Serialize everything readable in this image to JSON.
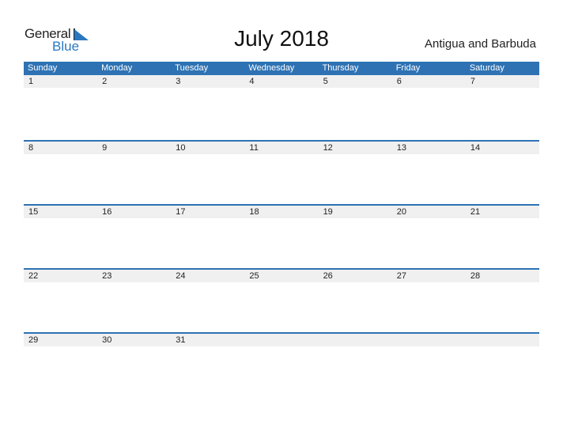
{
  "logo": {
    "word1": "General",
    "word2": "Blue"
  },
  "title": "July 2018",
  "country": "Antigua and Barbuda",
  "colors": {
    "accent": "#2e72b3",
    "date_strip": "#f0f0f0"
  },
  "weekdays": [
    "Sunday",
    "Monday",
    "Tuesday",
    "Wednesday",
    "Thursday",
    "Friday",
    "Saturday"
  ],
  "weeks": [
    [
      "1",
      "2",
      "3",
      "4",
      "5",
      "6",
      "7"
    ],
    [
      "8",
      "9",
      "10",
      "11",
      "12",
      "13",
      "14"
    ],
    [
      "15",
      "16",
      "17",
      "18",
      "19",
      "20",
      "21"
    ],
    [
      "22",
      "23",
      "24",
      "25",
      "26",
      "27",
      "28"
    ],
    [
      "29",
      "30",
      "31",
      "",
      "",
      "",
      ""
    ]
  ]
}
